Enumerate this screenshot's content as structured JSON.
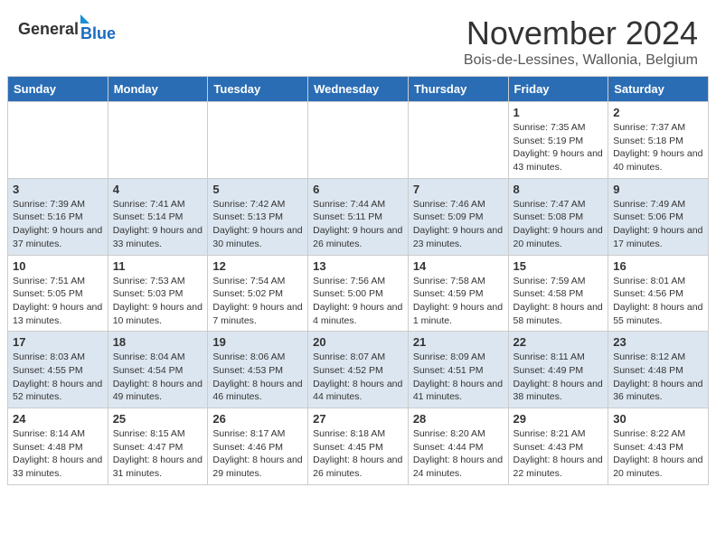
{
  "header": {
    "logo_general": "General",
    "logo_blue": "Blue",
    "month_title": "November 2024",
    "location": "Bois-de-Lessines, Wallonia, Belgium"
  },
  "days_of_week": [
    "Sunday",
    "Monday",
    "Tuesday",
    "Wednesday",
    "Thursday",
    "Friday",
    "Saturday"
  ],
  "weeks": [
    {
      "days": [
        {
          "num": "",
          "info": ""
        },
        {
          "num": "",
          "info": ""
        },
        {
          "num": "",
          "info": ""
        },
        {
          "num": "",
          "info": ""
        },
        {
          "num": "",
          "info": ""
        },
        {
          "num": "1",
          "info": "Sunrise: 7:35 AM\nSunset: 5:19 PM\nDaylight: 9 hours and 43 minutes."
        },
        {
          "num": "2",
          "info": "Sunrise: 7:37 AM\nSunset: 5:18 PM\nDaylight: 9 hours and 40 minutes."
        }
      ]
    },
    {
      "days": [
        {
          "num": "3",
          "info": "Sunrise: 7:39 AM\nSunset: 5:16 PM\nDaylight: 9 hours and 37 minutes."
        },
        {
          "num": "4",
          "info": "Sunrise: 7:41 AM\nSunset: 5:14 PM\nDaylight: 9 hours and 33 minutes."
        },
        {
          "num": "5",
          "info": "Sunrise: 7:42 AM\nSunset: 5:13 PM\nDaylight: 9 hours and 30 minutes."
        },
        {
          "num": "6",
          "info": "Sunrise: 7:44 AM\nSunset: 5:11 PM\nDaylight: 9 hours and 26 minutes."
        },
        {
          "num": "7",
          "info": "Sunrise: 7:46 AM\nSunset: 5:09 PM\nDaylight: 9 hours and 23 minutes."
        },
        {
          "num": "8",
          "info": "Sunrise: 7:47 AM\nSunset: 5:08 PM\nDaylight: 9 hours and 20 minutes."
        },
        {
          "num": "9",
          "info": "Sunrise: 7:49 AM\nSunset: 5:06 PM\nDaylight: 9 hours and 17 minutes."
        }
      ]
    },
    {
      "days": [
        {
          "num": "10",
          "info": "Sunrise: 7:51 AM\nSunset: 5:05 PM\nDaylight: 9 hours and 13 minutes."
        },
        {
          "num": "11",
          "info": "Sunrise: 7:53 AM\nSunset: 5:03 PM\nDaylight: 9 hours and 10 minutes."
        },
        {
          "num": "12",
          "info": "Sunrise: 7:54 AM\nSunset: 5:02 PM\nDaylight: 9 hours and 7 minutes."
        },
        {
          "num": "13",
          "info": "Sunrise: 7:56 AM\nSunset: 5:00 PM\nDaylight: 9 hours and 4 minutes."
        },
        {
          "num": "14",
          "info": "Sunrise: 7:58 AM\nSunset: 4:59 PM\nDaylight: 9 hours and 1 minute."
        },
        {
          "num": "15",
          "info": "Sunrise: 7:59 AM\nSunset: 4:58 PM\nDaylight: 8 hours and 58 minutes."
        },
        {
          "num": "16",
          "info": "Sunrise: 8:01 AM\nSunset: 4:56 PM\nDaylight: 8 hours and 55 minutes."
        }
      ]
    },
    {
      "days": [
        {
          "num": "17",
          "info": "Sunrise: 8:03 AM\nSunset: 4:55 PM\nDaylight: 8 hours and 52 minutes."
        },
        {
          "num": "18",
          "info": "Sunrise: 8:04 AM\nSunset: 4:54 PM\nDaylight: 8 hours and 49 minutes."
        },
        {
          "num": "19",
          "info": "Sunrise: 8:06 AM\nSunset: 4:53 PM\nDaylight: 8 hours and 46 minutes."
        },
        {
          "num": "20",
          "info": "Sunrise: 8:07 AM\nSunset: 4:52 PM\nDaylight: 8 hours and 44 minutes."
        },
        {
          "num": "21",
          "info": "Sunrise: 8:09 AM\nSunset: 4:51 PM\nDaylight: 8 hours and 41 minutes."
        },
        {
          "num": "22",
          "info": "Sunrise: 8:11 AM\nSunset: 4:49 PM\nDaylight: 8 hours and 38 minutes."
        },
        {
          "num": "23",
          "info": "Sunrise: 8:12 AM\nSunset: 4:48 PM\nDaylight: 8 hours and 36 minutes."
        }
      ]
    },
    {
      "days": [
        {
          "num": "24",
          "info": "Sunrise: 8:14 AM\nSunset: 4:48 PM\nDaylight: 8 hours and 33 minutes."
        },
        {
          "num": "25",
          "info": "Sunrise: 8:15 AM\nSunset: 4:47 PM\nDaylight: 8 hours and 31 minutes."
        },
        {
          "num": "26",
          "info": "Sunrise: 8:17 AM\nSunset: 4:46 PM\nDaylight: 8 hours and 29 minutes."
        },
        {
          "num": "27",
          "info": "Sunrise: 8:18 AM\nSunset: 4:45 PM\nDaylight: 8 hours and 26 minutes."
        },
        {
          "num": "28",
          "info": "Sunrise: 8:20 AM\nSunset: 4:44 PM\nDaylight: 8 hours and 24 minutes."
        },
        {
          "num": "29",
          "info": "Sunrise: 8:21 AM\nSunset: 4:43 PM\nDaylight: 8 hours and 22 minutes."
        },
        {
          "num": "30",
          "info": "Sunrise: 8:22 AM\nSunset: 4:43 PM\nDaylight: 8 hours and 20 minutes."
        }
      ]
    }
  ]
}
